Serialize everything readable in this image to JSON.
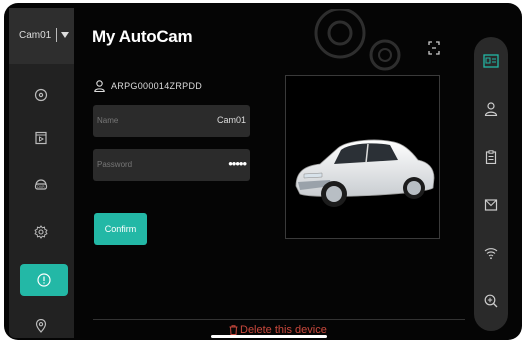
{
  "camera_selector": {
    "name": "Cam01"
  },
  "header": {
    "title": "My AutoCam"
  },
  "sidebar": {
    "items": [
      {
        "icon": "record-icon"
      },
      {
        "icon": "playback-icon"
      },
      {
        "icon": "dvr-icon"
      },
      {
        "icon": "settings-icon"
      },
      {
        "icon": "info-icon",
        "active": true
      },
      {
        "icon": "location-icon"
      }
    ]
  },
  "device": {
    "id": "ARPG000014ZRPDD",
    "name_label": "Name",
    "name_value": "Cam01",
    "password_label": "Password",
    "password_value": "•••••",
    "confirm_label": "Confirm",
    "delete_label": "Delete this device"
  },
  "right_rail": {
    "items": [
      {
        "icon": "device-card-icon",
        "active": true
      },
      {
        "icon": "user-icon"
      },
      {
        "icon": "clipboard-icon"
      },
      {
        "icon": "mail-icon"
      },
      {
        "icon": "wifi-icon"
      },
      {
        "icon": "zoom-in-icon"
      }
    ]
  },
  "colors": {
    "accent": "#23b8a6",
    "danger": "#c8483c",
    "background": "#050505",
    "panel": "#222222"
  }
}
